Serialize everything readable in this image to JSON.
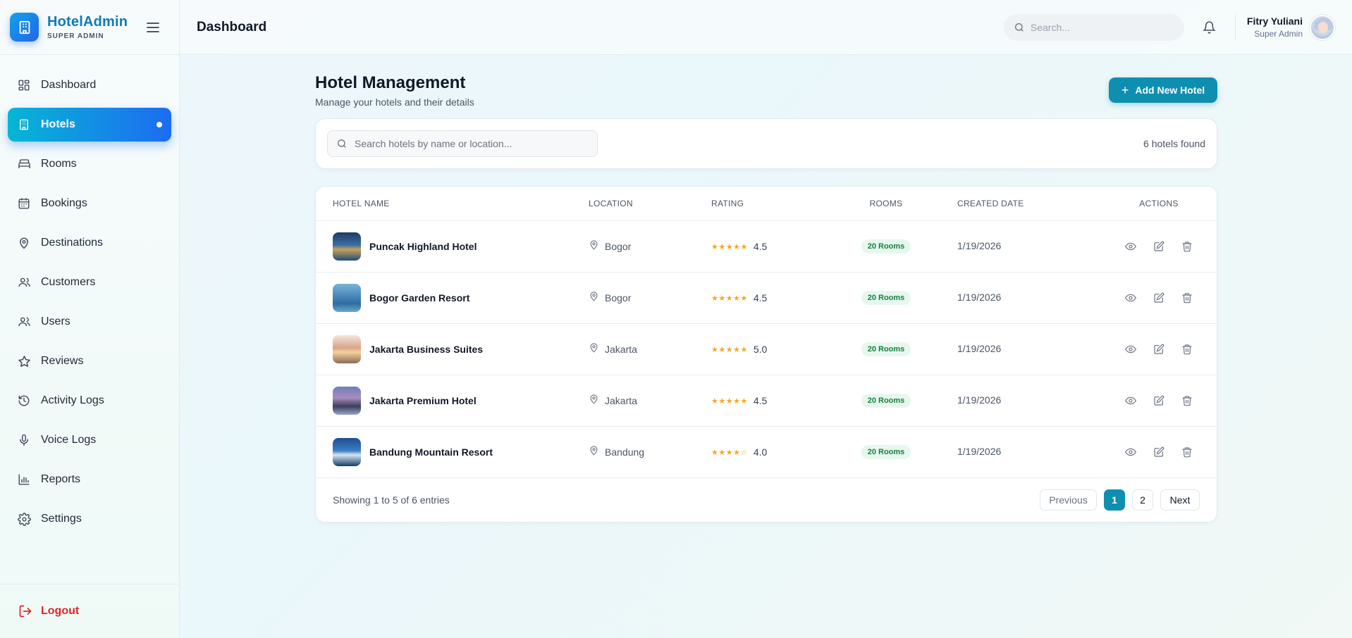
{
  "brand": {
    "title": "HotelAdmin",
    "subtitle": "SUPER ADMIN"
  },
  "sidebar": {
    "items": [
      {
        "label": "Dashboard",
        "icon": "dashboard-icon"
      },
      {
        "label": "Hotels",
        "icon": "building-icon",
        "active": true
      },
      {
        "label": "Rooms",
        "icon": "bed-icon"
      },
      {
        "label": "Bookings",
        "icon": "calendar-icon"
      },
      {
        "label": "Destinations",
        "icon": "map-pin-icon"
      },
      {
        "label": "Customers",
        "icon": "users-icon"
      },
      {
        "label": "Users",
        "icon": "users-icon"
      },
      {
        "label": "Reviews",
        "icon": "star-icon"
      },
      {
        "label": "Activity Logs",
        "icon": "history-icon"
      },
      {
        "label": "Voice Logs",
        "icon": "microphone-icon"
      },
      {
        "label": "Reports",
        "icon": "bar-chart-icon"
      },
      {
        "label": "Settings",
        "icon": "gear-icon"
      }
    ],
    "logout_label": "Logout"
  },
  "header": {
    "title": "Dashboard",
    "search_placeholder": "Search...",
    "user_name": "Fitry Yuliani",
    "user_role": "Super Admin"
  },
  "page": {
    "title": "Hotel Management",
    "subtitle": "Manage your hotels and their details",
    "add_button": "Add New Hotel",
    "search_placeholder": "Search hotels by name or location...",
    "count_text": "6 hotels found"
  },
  "table": {
    "headers": {
      "name": "HOTEL NAME",
      "location": "LOCATION",
      "rating": "RATING",
      "rooms": "ROOMS",
      "created": "CREATED DATE",
      "actions": "ACTIONS"
    },
    "rows": [
      {
        "name": "Puncak Highland Hotel",
        "location": "Bogor",
        "stars": "★★★★★",
        "rating": "4.5",
        "rooms": "20 Rooms",
        "created": "1/19/2026"
      },
      {
        "name": "Bogor Garden Resort",
        "location": "Bogor",
        "stars": "★★★★★",
        "rating": "4.5",
        "rooms": "20 Rooms",
        "created": "1/19/2026"
      },
      {
        "name": "Jakarta Business Suites",
        "location": "Jakarta",
        "stars": "★★★★★",
        "rating": "5.0",
        "rooms": "20 Rooms",
        "created": "1/19/2026"
      },
      {
        "name": "Jakarta Premium Hotel",
        "location": "Jakarta",
        "stars": "★★★★★",
        "rating": "4.5",
        "rooms": "20 Rooms",
        "created": "1/19/2026"
      },
      {
        "name": "Bandung Mountain Resort",
        "location": "Bandung",
        "stars": "★★★★☆",
        "rating": "4.0",
        "rooms": "20 Rooms",
        "created": "1/19/2026"
      }
    ]
  },
  "pagination": {
    "showing_text": "Showing 1 to 5 of 6 entries",
    "prev_label": "Previous",
    "pages": [
      "1",
      "2"
    ],
    "current_page": "1",
    "next_label": "Next"
  },
  "colors": {
    "accent": "#0e8fb0",
    "active_nav_start": "#06b6d4",
    "active_nav_end": "#1d6cf2",
    "star": "#f5a623",
    "rooms_badge_bg": "#e7f7ee",
    "rooms_badge_text": "#15803d",
    "logout": "#dc2626"
  }
}
